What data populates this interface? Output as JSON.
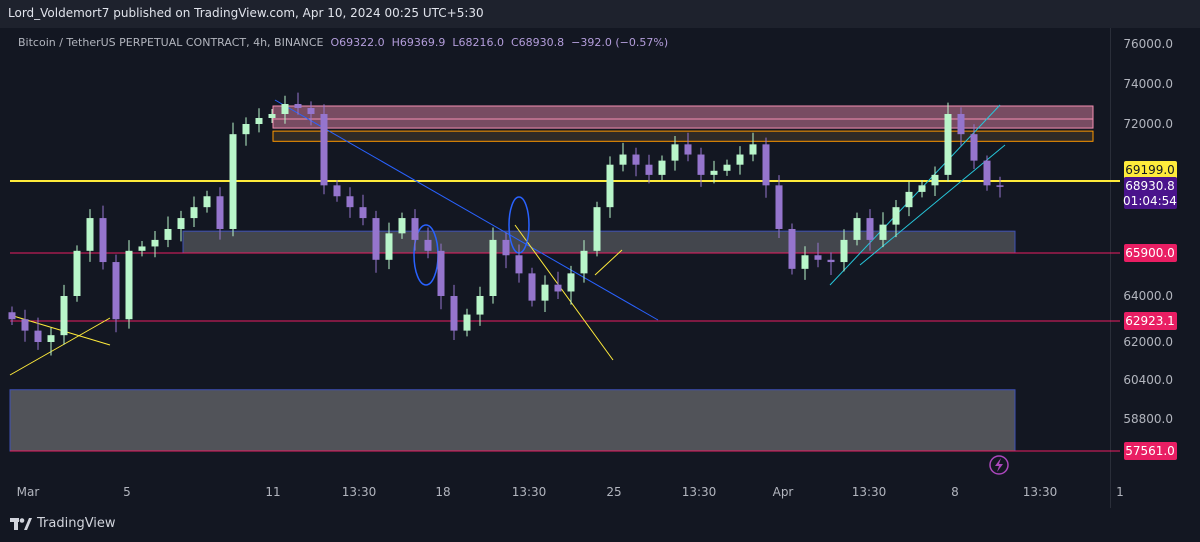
{
  "header": {
    "published": "Lord_Voldemort7 published on TradingView.com, Apr 10, 2024 00:25 UTC+5:30"
  },
  "legend": {
    "symbol": "Bitcoin / TetherUS PERPETUAL CONTRACT, 4h, BINANCE",
    "open": "O69322.0",
    "high": "H69369.9",
    "low": "L68216.0",
    "close": "C68930.8",
    "change": "−392.0 (−0.57%)"
  },
  "footer": {
    "brand": "TradingView",
    "logo_icon": "tradingview-logo-icon"
  },
  "chart_data": {
    "type": "candlestick",
    "title": "Bitcoin / TetherUS PERPETUAL CONTRACT, 4h, BINANCE",
    "y_ticks": [
      "76000.0",
      "74000.0",
      "72000.0",
      "64000.0",
      "62000.0",
      "60400.0",
      "58800.0"
    ],
    "x_ticks": [
      "Mar",
      "5",
      "11",
      "13:30",
      "18",
      "13:30",
      "25",
      "13:30",
      "Apr",
      "13:30",
      "8",
      "13:30",
      "1"
    ],
    "price_labels": [
      {
        "text": "69199.0",
        "color": "#ffeb3b",
        "kind": "horizontal-line"
      },
      {
        "text": "68930.8",
        "color": "#4a148c",
        "kind": "last-price"
      },
      {
        "text": "01:04:54",
        "color": "#4a148c",
        "kind": "countdown"
      },
      {
        "text": "65900.0",
        "color": "#e91e63",
        "kind": "horizontal-line"
      },
      {
        "text": "62923.1",
        "color": "#e91e63",
        "kind": "horizontal-line"
      },
      {
        "text": "57561.0",
        "color": "#e91e63",
        "kind": "horizontal-line"
      }
    ],
    "zones": [
      {
        "from": 72250,
        "to": 72900,
        "color": "#f48fb1"
      },
      {
        "from": 71800,
        "to": 72250,
        "color": "#f48fb1"
      },
      {
        "from": 71150,
        "to": 71650,
        "color": "#ffb74d"
      },
      {
        "from": 65900,
        "to": 66900,
        "color": "#9e9e9e"
      },
      {
        "from": 57561,
        "to": 60000,
        "color": "#9e9e9e"
      }
    ],
    "candle_up_color": "#b9f6ca",
    "candle_down_color": "#9575cd",
    "closes_approx": [
      63000,
      62500,
      62000,
      62300,
      64000,
      66000,
      67500,
      65500,
      63000,
      66000,
      66200,
      66500,
      67000,
      67500,
      68000,
      68500,
      67000,
      71500,
      72000,
      72300,
      72500,
      73000,
      72800,
      72500,
      69000,
      68500,
      68000,
      67500,
      65600,
      66800,
      67500,
      66500,
      66000,
      64000,
      62500,
      63200,
      64000,
      66500,
      65800,
      65000,
      63800,
      64500,
      64200,
      65000,
      66000,
      68000,
      70000,
      70500,
      70000,
      69500,
      70200,
      71000,
      70500,
      69500,
      69700,
      70000,
      70500,
      71000,
      69000,
      67000,
      65200,
      65800,
      65600,
      65500,
      66500,
      67500,
      66500,
      67200,
      68000,
      68700,
      69000,
      69500,
      72500,
      71500,
      70200,
      69000,
      68930.8
    ]
  }
}
